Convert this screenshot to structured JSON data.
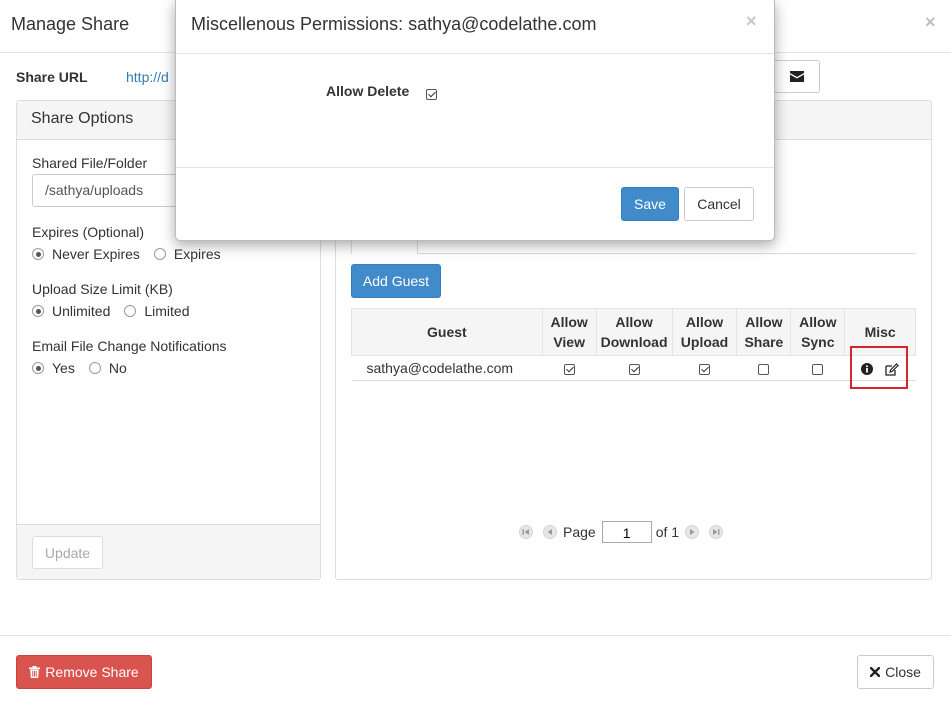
{
  "manage_share": {
    "title": "Manage Share",
    "close_glyph": "×",
    "share_url_label": "Share URL",
    "share_url_value": "http://d",
    "email_icon": "envelope-icon"
  },
  "share_options": {
    "title": "Share Options",
    "shared_label": "Shared File/Folder",
    "shared_value": "/sathya/uploads",
    "expires_label": "Expires (Optional)",
    "expires_opts": [
      "Never Expires",
      "Expires"
    ],
    "upload_label": "Upload Size Limit (KB)",
    "upload_opts": [
      "Unlimited",
      "Limited"
    ],
    "email_label": "Email File Change Notifications",
    "email_opts": [
      "Yes",
      "No"
    ],
    "update_label": "Update"
  },
  "guests": {
    "add_label": "Add Guest",
    "headers": {
      "guest": "Guest",
      "view": [
        "Allow",
        "View"
      ],
      "download": [
        "Allow",
        "Download"
      ],
      "upload": [
        "Allow",
        "Upload"
      ],
      "share": [
        "Allow",
        "Share"
      ],
      "sync": [
        "Allow",
        "Sync"
      ],
      "misc": "Misc"
    },
    "rows": [
      {
        "email": "sathya@codelathe.com",
        "view": true,
        "download": true,
        "upload": true,
        "share": false,
        "sync": false
      }
    ]
  },
  "pager": {
    "page_label": "Page",
    "current": "1",
    "of_label": "of 1"
  },
  "footer": {
    "remove_label": "Remove Share",
    "close_label": "Close"
  },
  "modal": {
    "title": "Miscellenous Permissions: sathya@codelathe.com",
    "close_glyph": "×",
    "allow_delete_label": "Allow Delete",
    "allow_delete_checked": true,
    "save_label": "Save",
    "cancel_label": "Cancel"
  },
  "colors": {
    "primary": "#428bca",
    "danger": "#d9534f",
    "highlight": "#d9232d",
    "link": "#337ab7"
  }
}
